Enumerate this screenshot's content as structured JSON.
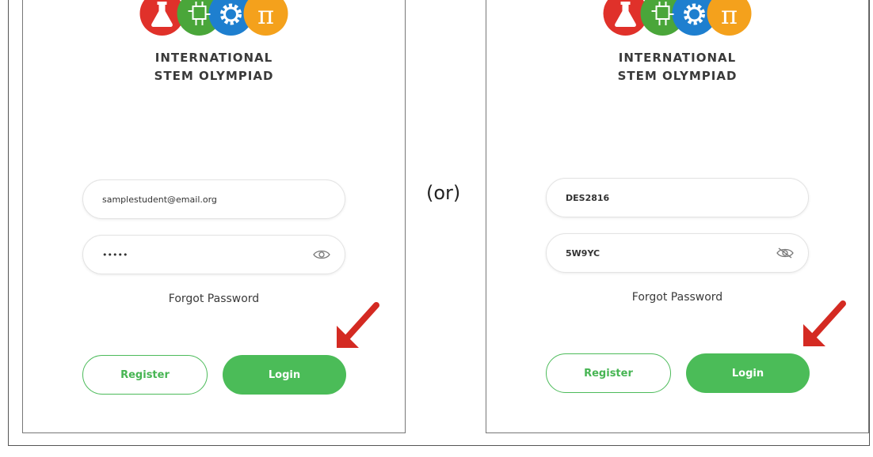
{
  "brand": {
    "line1": "INTERNATIONAL",
    "line2": "STEM OLYMPIAD",
    "logo_icons": [
      "flask-icon",
      "circuit-chip-icon",
      "gear-icon",
      "pi-icon"
    ],
    "logo_colors": [
      "#e0312a",
      "#4aa63a",
      "#1e7fcf",
      "#f4a11c"
    ]
  },
  "separator": "(or)",
  "left_form": {
    "email_value": "samplestudent@email.org",
    "password_value": "•••••",
    "password_icon": "eye-icon",
    "forgot_label": "Forgot Password",
    "register_label": "Register",
    "login_label": "Login"
  },
  "right_form": {
    "code_value": "DES2816",
    "password_value": "5W9YC",
    "password_icon": "eye-slash-icon",
    "forgot_label": "Forgot Password",
    "register_label": "Register",
    "login_label": "Login"
  },
  "colors": {
    "accent_green": "#4bbc58",
    "arrow_red": "#d42a22"
  }
}
